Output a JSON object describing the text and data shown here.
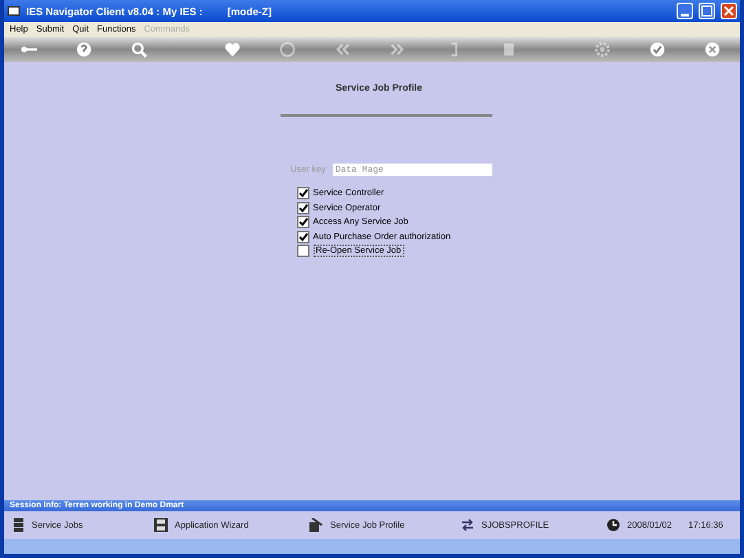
{
  "window": {
    "title": "IES Navigator Client v8.04 : My IES :",
    "mode": "[mode-Z]"
  },
  "menu": [
    {
      "label": "Help",
      "disabled": false
    },
    {
      "label": "Submit",
      "disabled": false
    },
    {
      "label": "Quit",
      "disabled": false
    },
    {
      "label": "Functions",
      "disabled": false
    },
    {
      "label": "Commands",
      "disabled": true
    }
  ],
  "toolbar": [
    {
      "kind": "key",
      "disabled": false
    },
    {
      "kind": "help",
      "disabled": false
    },
    {
      "kind": "search",
      "disabled": false
    },
    {
      "kind": "heart",
      "disabled": false
    },
    {
      "kind": "circle",
      "disabled": true
    },
    {
      "kind": "back",
      "disabled": true
    },
    {
      "kind": "forward",
      "disabled": true
    },
    {
      "kind": "bracket",
      "disabled": true
    },
    {
      "kind": "square",
      "disabled": true
    },
    {
      "kind": "gear",
      "disabled": true
    },
    {
      "kind": "check",
      "disabled": false
    },
    {
      "kind": "close",
      "disabled": false
    }
  ],
  "form": {
    "title": "Service Job Profile",
    "field": {
      "label": "User key",
      "value": "Data Mage"
    },
    "options": [
      {
        "label": "Service Controller",
        "checked": true
      },
      {
        "label": "Service Operator",
        "checked": true
      },
      {
        "label": "Access Any Service Job",
        "checked": true
      },
      {
        "label": "Auto Purchase Order authorization",
        "checked": true
      },
      {
        "label": "Re-Open Service Job",
        "checked": false
      }
    ]
  },
  "session_info": "Session Info: Terren working in Demo Dmart",
  "status_bar": [
    {
      "kind": "jobs",
      "text": "Service Jobs"
    },
    {
      "kind": "wizard",
      "text": "Application Wizard"
    },
    {
      "kind": "profile",
      "text": "Service Job Profile"
    },
    {
      "kind": "code",
      "text": "SJOBSPROFILE"
    },
    {
      "kind": "clock",
      "text": "2008/01/02"
    },
    {
      "kind": "time",
      "text": "17:16:36"
    }
  ]
}
